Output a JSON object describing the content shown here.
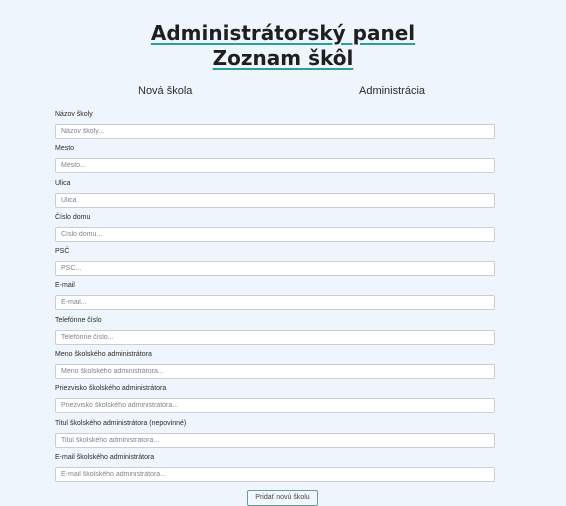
{
  "header": {
    "title": "Administrátorský panel",
    "subtitle": "Zoznam škôl"
  },
  "tabs": {
    "new_school": "Nová škola",
    "administration": "Administrácia"
  },
  "form": {
    "fields": [
      {
        "label": "Názov školy",
        "placeholder": "Názov školy...",
        "value": ""
      },
      {
        "label": "Mesto",
        "placeholder": "Mesto...",
        "value": ""
      },
      {
        "label": "Ulica",
        "placeholder": "Ulica",
        "value": ""
      },
      {
        "label": "Číslo domu",
        "placeholder": "Číslo domu...",
        "value": ""
      },
      {
        "label": "PSČ",
        "placeholder": "PSČ...",
        "value": ""
      },
      {
        "label": "E-mail",
        "placeholder": "E-mail...",
        "value": ""
      },
      {
        "label": "Telefónne číslo",
        "placeholder": "Telefónne číslo...",
        "value": ""
      },
      {
        "label": "Meno školského administrátora",
        "placeholder": "Meno školského administrátora...",
        "value": ""
      },
      {
        "label": "Priezvisko školského administrátora",
        "placeholder": "Priezvisko školského administrátora...",
        "value": ""
      },
      {
        "label": "Titul školského administrátora (nepovinné)",
        "placeholder": "Titul školského administrátora...",
        "value": ""
      },
      {
        "label": "E-mail školského administrátora",
        "placeholder": "E-mail školského administrátora...",
        "value": ""
      }
    ],
    "submit_label": "Pridať novú školu"
  },
  "colors": {
    "background": "#eef5fc",
    "title_underline": "#2aa198",
    "button_border": "#6c9a96"
  }
}
